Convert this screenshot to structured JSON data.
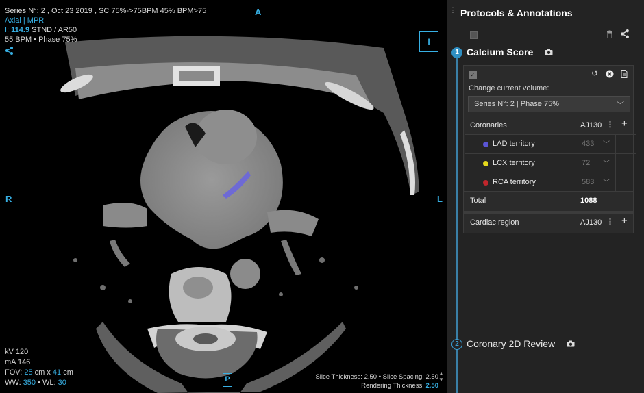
{
  "viewer": {
    "line1": "Series N°: 2 , Oct 23 2019 , SC 75%->75BPM 45% BPM>75",
    "line2": "Axial | MPR",
    "line3_prefix": "I: ",
    "line3_value": "114.9",
    "line3_suffix": " STND / AR50",
    "line4": "55 BPM • Phase 75%",
    "orient_top": "A",
    "orient_left": "R",
    "orient_right": "L",
    "orient_bottom": "P",
    "orient_box": "I",
    "kv": "kV 120",
    "ma": "mA 146",
    "fov_label": "FOV: ",
    "fov_w": "25",
    "fov_mid": " cm x ",
    "fov_h": "41",
    "fov_unit": " cm",
    "ww_label": "WW: ",
    "ww_value": "350",
    "wl_label": " • WL: ",
    "wl_value": "30",
    "slice_info": "Slice Thickness: 2.50 • Slice Spacing: 2.50",
    "render_label": "Rendering Thickness: ",
    "render_value": "2.50",
    "share_icon": "share-icon"
  },
  "panel": {
    "title": "Protocols & Annotations",
    "sections": [
      {
        "number": "1",
        "title": "Calcium Score"
      },
      {
        "number": "2",
        "title": "Coronary 2D Review"
      }
    ],
    "card": {
      "volume_label": "Change current volume:",
      "volume_value": "Series N°: 2 | Phase 75%",
      "coronaries": {
        "label": "Coronaries",
        "code": "AJ130"
      },
      "territories": [
        {
          "name": "LAD territory",
          "value": "433",
          "color": "#5a55d6"
        },
        {
          "name": "LCX territory",
          "value": "72",
          "color": "#e5d81c"
        },
        {
          "name": "RCA territory",
          "value": "583",
          "color": "#c0262c"
        }
      ],
      "total": {
        "label": "Total",
        "value": "1088"
      },
      "cardiac": {
        "label": "Cardiac region",
        "code": "AJ130"
      }
    }
  }
}
